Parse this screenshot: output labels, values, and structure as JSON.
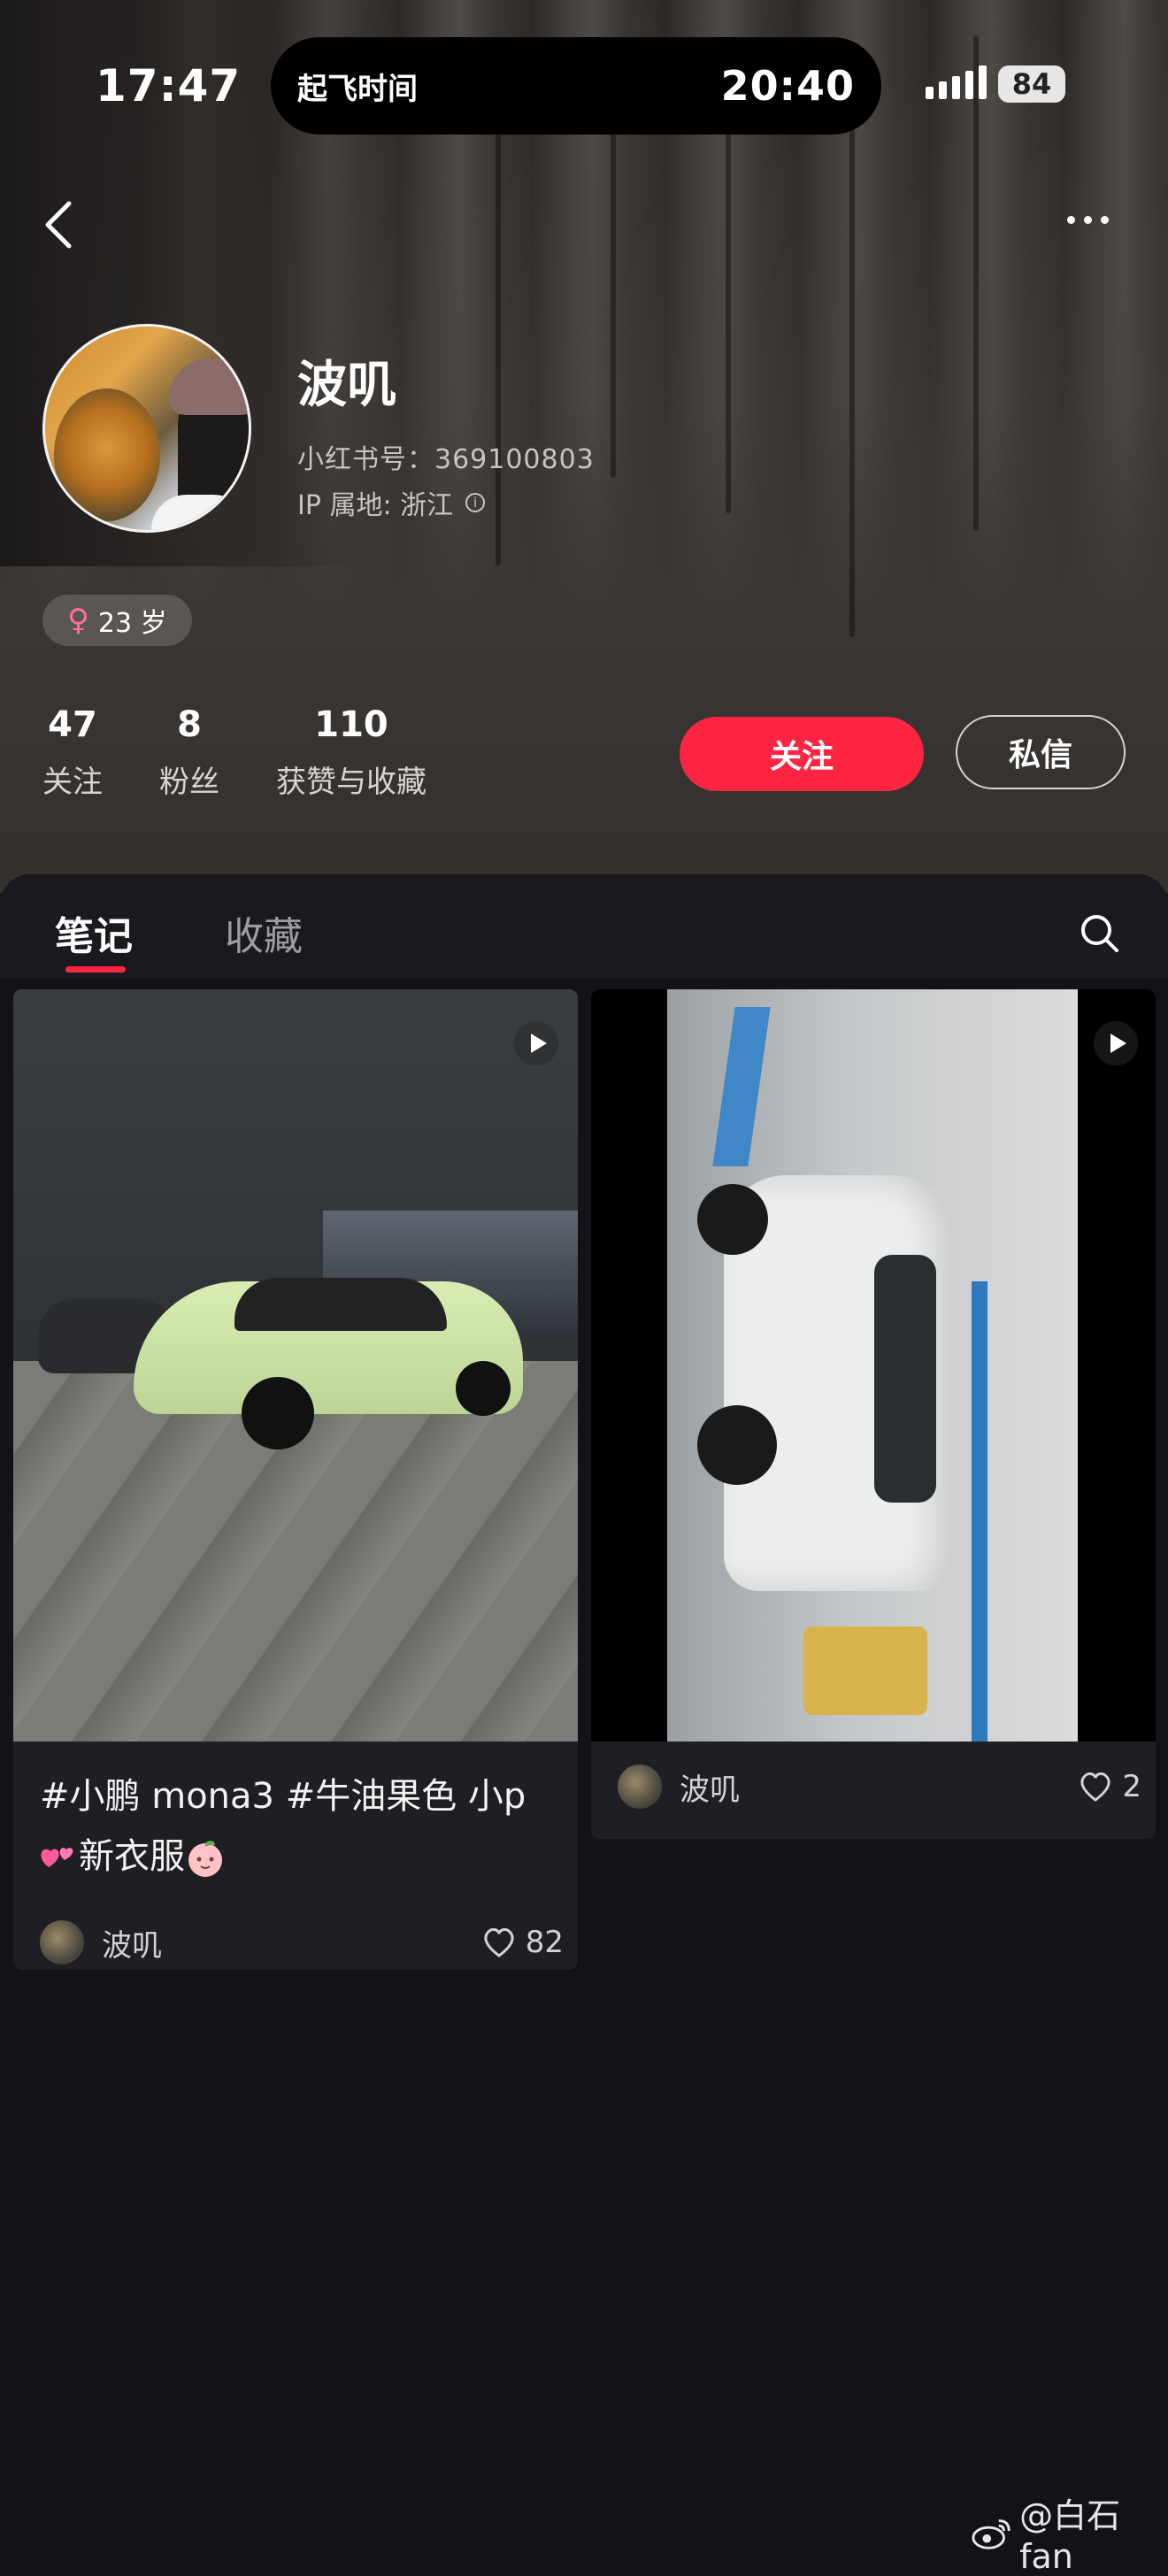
{
  "status_bar": {
    "time": "17:47",
    "island_label": "起飞时间",
    "island_time": "20:40",
    "battery": "84"
  },
  "profile": {
    "nickname": "波叽",
    "redbook_id": "小红书号：369100803",
    "ip_location": "IP 属地: 浙江",
    "age": "23 岁"
  },
  "stats": [
    {
      "value": "47",
      "label": "关注"
    },
    {
      "value": "8",
      "label": "粉丝"
    },
    {
      "value": "110",
      "label": "获赞与收藏"
    }
  ],
  "actions": {
    "follow": "关注",
    "message": "私信"
  },
  "tabs": [
    {
      "label": "笔记",
      "active": true
    },
    {
      "label": "收藏",
      "active": false
    }
  ],
  "notes": [
    {
      "title_line1": "#小鹏 mona3 #牛油果色 小p",
      "title_line2": "新衣服",
      "author": "波叽",
      "likes": "82",
      "is_video": true
    },
    {
      "title_line1": "",
      "author": "波叽",
      "likes": "2",
      "is_video": true
    }
  ],
  "watermark": "@白石fan",
  "colors": {
    "accent": "#ff2442",
    "background": "#131217",
    "card": "#1f1e23"
  },
  "icons": [
    "back-icon",
    "more-icon",
    "info-icon",
    "female-icon",
    "search-icon",
    "play-icon",
    "heart-icon",
    "weibo-icon"
  ]
}
